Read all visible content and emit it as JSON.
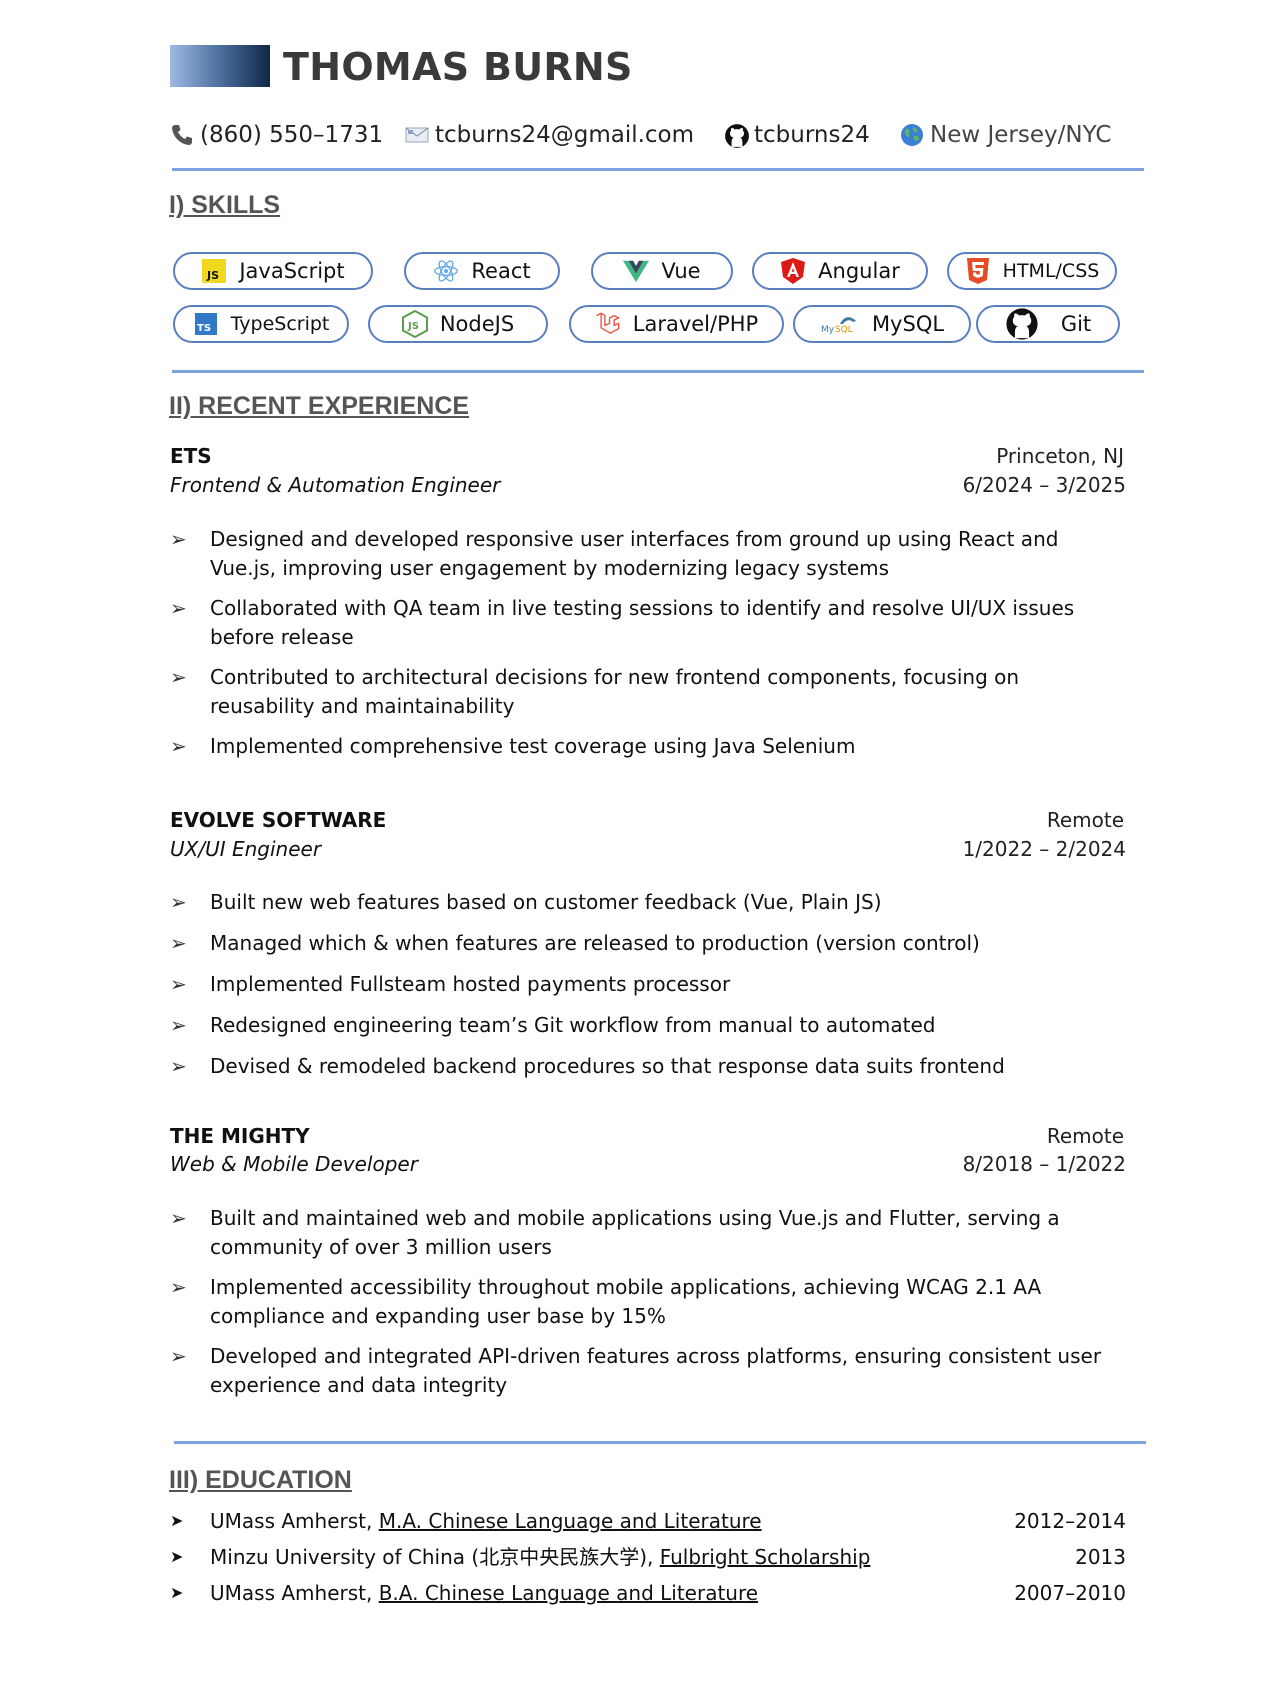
{
  "header": {
    "name": "THOMAS BURNS",
    "accent_color": "#7ea2dd",
    "contacts": [
      {
        "icon": "phone-icon",
        "text": "(860) 550–1731"
      },
      {
        "icon": "email-icon",
        "text": "tcburns24@gmail.com"
      },
      {
        "icon": "github-icon",
        "text": "tcburns24"
      },
      {
        "icon": "globe-icon",
        "text": "New Jersey/NYC"
      }
    ]
  },
  "skills": {
    "title": "I) SKILLS",
    "items": [
      {
        "label": "JavaScript",
        "icon": "javascript-icon"
      },
      {
        "label": "React",
        "icon": "react-icon"
      },
      {
        "label": "Vue",
        "icon": "vue-icon"
      },
      {
        "label": "Angular",
        "icon": "angular-icon"
      },
      {
        "label": "HTML/CSS",
        "icon": "html5-icon"
      },
      {
        "label": "TypeScript",
        "icon": "typescript-icon"
      },
      {
        "label": "NodeJS",
        "icon": "nodejs-icon"
      },
      {
        "label": "Laravel/PHP",
        "icon": "laravel-icon"
      },
      {
        "label": "MySQL",
        "icon": "mysql-icon"
      },
      {
        "label": "Git",
        "icon": "github-icon"
      }
    ]
  },
  "experience": {
    "title": "II) RECENT EXPERIENCE",
    "jobs": [
      {
        "company": "ETS",
        "role": "Frontend & Automation Engineer",
        "location": "Princeton, NJ",
        "dates": "6/2024 – 3/2025",
        "bullets": [
          "Designed and developed responsive user interfaces from ground up using React and Vue.js, improving user engagement by modernizing legacy systems",
          "Collaborated with QA team in live testing sessions to identify and resolve UI/UX issues before release",
          "Contributed to architectural decisions for new frontend components, focusing on reusability and maintainability",
          "Implemented comprehensive test coverage using Java Selenium"
        ]
      },
      {
        "company": "EVOLVE SOFTWARE",
        "role": "UX/UI Engineer",
        "location": "Remote",
        "dates": "1/2022 – 2/2024",
        "bullets": [
          "Built new web features based on customer feedback (Vue, Plain JS)",
          "Managed which & when features are released to production (version control)",
          "Implemented Fullsteam hosted payments processor",
          "Redesigned engineering team’s Git workflow from manual to automated",
          "Devised & remodeled backend procedures so that response data suits frontend"
        ]
      },
      {
        "company": "THE MIGHTY",
        "role": "Web & Mobile Developer",
        "location": "Remote",
        "dates": "8/2018 – 1/2022",
        "bullets": [
          "Built and maintained web and mobile applications using Vue.js and Flutter, serving a community of over 3 million users",
          "Implemented accessibility throughout mobile applications, achieving WCAG 2.1 AA compliance and expanding user base by 15%",
          "Developed and integrated API-driven features across platforms, ensuring consistent user experience and data integrity"
        ]
      }
    ]
  },
  "education": {
    "title": "III) EDUCATION",
    "items": [
      {
        "school": "UMass Amherst, ",
        "degree": "M.A. Chinese Language and Literature",
        "years": "2012–2014"
      },
      {
        "school": "Minzu University of China (北京中央民族大学), ",
        "degree": "Fulbright Scholarship",
        "years": "2013"
      },
      {
        "school": "UMass Amherst, ",
        "degree": "B.A. Chinese Language and Literature",
        "years": "2007–2010"
      }
    ]
  }
}
